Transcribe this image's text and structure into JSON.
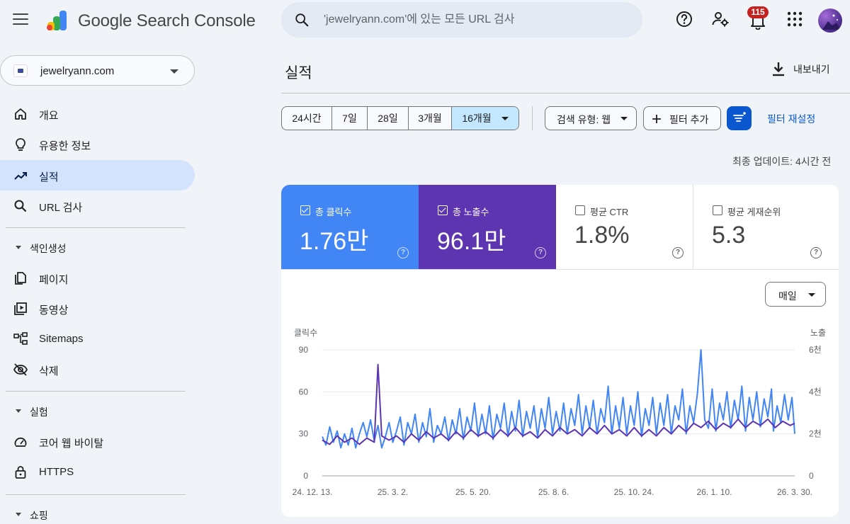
{
  "header": {
    "brand": "Google Search Console",
    "search_placeholder": "'jewelryann.com'에 있는 모든 URL 검사",
    "notifications_count": "115",
    "icons": [
      "menu-icon",
      "search-icon",
      "help-icon",
      "manage-users-icon",
      "notifications-icon",
      "apps-icon"
    ]
  },
  "sidebar": {
    "property": "jewelryann.com",
    "items": [
      {
        "label": "개요",
        "icon": "home-icon"
      },
      {
        "label": "유용한 정보",
        "icon": "lightbulb-icon"
      },
      {
        "label": "실적",
        "icon": "trending-up-icon",
        "active": true
      },
      {
        "label": "URL 검사",
        "icon": "search-icon"
      }
    ],
    "sections": [
      {
        "label": "색인생성",
        "items": [
          {
            "label": "페이지",
            "icon": "pages-icon"
          },
          {
            "label": "동영상",
            "icon": "video-icon"
          },
          {
            "label": "Sitemaps",
            "icon": "sitemap-icon"
          },
          {
            "label": "삭제",
            "icon": "visibility-off-icon"
          }
        ]
      },
      {
        "label": "실험",
        "items": [
          {
            "label": "코어 웹 바이탈",
            "icon": "speed-icon"
          },
          {
            "label": "HTTPS",
            "icon": "lock-icon"
          }
        ]
      },
      {
        "label": "쇼핑",
        "items": []
      }
    ]
  },
  "main": {
    "title": "실적",
    "export_label": "내보내기",
    "ranges": [
      "24시간",
      "7일",
      "28일",
      "3개월",
      "16개월"
    ],
    "selected_range": "16개월",
    "search_type": "검색 유형: 웹",
    "add_filter": "필터 추가",
    "reset_filters": "필터 재설정",
    "last_updated": "최종 업데이트: 4시간 전",
    "granularity": "매일",
    "colors": {
      "clicks": "#4285f4",
      "impressions": "#5e35b1",
      "primary": "#0b57d0"
    }
  },
  "metrics": [
    {
      "label": "총 클릭수",
      "value": "1.76만",
      "checked": true
    },
    {
      "label": "총 노출수",
      "value": "96.1만",
      "checked": true
    },
    {
      "label": "평균 CTR",
      "value": "1.8%",
      "checked": false
    },
    {
      "label": "평균 게재순위",
      "value": "5.3",
      "checked": false
    }
  ],
  "chart_data": {
    "type": "line",
    "left_axis_label": "클릭수",
    "right_axis_label": "노출",
    "left_ticks": [
      "90",
      "60",
      "30",
      "0"
    ],
    "right_ticks": [
      "6천",
      "4천",
      "2천",
      "0"
    ],
    "ylim_left": [
      0,
      90
    ],
    "ylim_right": [
      0,
      6000
    ],
    "x_tick_labels": [
      "24. 12. 13.",
      "25. 3. 2.",
      "25. 5. 20.",
      "25. 8. 6.",
      "25. 10. 24.",
      "26. 1. 10.",
      "26. 3. 30."
    ],
    "series": [
      {
        "name": "클릭수",
        "axis": "left",
        "color": "#4285f4",
        "points": [
          [
            0,
            28
          ],
          [
            4,
            22
          ],
          [
            8,
            35
          ],
          [
            12,
            24
          ],
          [
            16,
            32
          ],
          [
            20,
            20
          ],
          [
            24,
            30
          ],
          [
            28,
            22
          ],
          [
            32,
            34
          ],
          [
            36,
            20
          ],
          [
            40,
            30
          ],
          [
            44,
            38
          ],
          [
            48,
            28
          ],
          [
            52,
            40
          ],
          [
            56,
            25
          ],
          [
            60,
            36
          ],
          [
            64,
            20
          ],
          [
            68,
            28
          ],
          [
            72,
            38
          ],
          [
            76,
            24
          ],
          [
            80,
            32
          ],
          [
            84,
            42
          ],
          [
            88,
            22
          ],
          [
            92,
            38
          ],
          [
            96,
            30
          ],
          [
            100,
            44
          ],
          [
            104,
            24
          ],
          [
            108,
            38
          ],
          [
            112,
            28
          ],
          [
            116,
            48
          ],
          [
            120,
            24
          ],
          [
            124,
            36
          ],
          [
            128,
            30
          ],
          [
            132,
            42
          ],
          [
            136,
            25
          ],
          [
            140,
            40
          ],
          [
            144,
            30
          ],
          [
            148,
            48
          ],
          [
            152,
            26
          ],
          [
            156,
            42
          ],
          [
            160,
            32
          ],
          [
            164,
            52
          ],
          [
            168,
            28
          ],
          [
            172,
            44
          ],
          [
            176,
            30
          ],
          [
            180,
            50
          ],
          [
            184,
            26
          ],
          [
            188,
            44
          ],
          [
            192,
            34
          ],
          [
            196,
            52
          ],
          [
            200,
            28
          ],
          [
            204,
            46
          ],
          [
            208,
            32
          ],
          [
            212,
            54
          ],
          [
            216,
            28
          ],
          [
            220,
            46
          ],
          [
            224,
            34
          ],
          [
            228,
            50
          ],
          [
            232,
            28
          ],
          [
            236,
            48
          ],
          [
            240,
            34
          ],
          [
            244,
            56
          ],
          [
            248,
            30
          ],
          [
            252,
            46
          ],
          [
            256,
            32
          ],
          [
            260,
            52
          ],
          [
            264,
            30
          ],
          [
            268,
            48
          ],
          [
            272,
            36
          ],
          [
            276,
            58
          ],
          [
            280,
            30
          ],
          [
            284,
            50
          ],
          [
            288,
            34
          ],
          [
            292,
            54
          ],
          [
            296,
            30
          ],
          [
            300,
            48
          ],
          [
            304,
            38
          ],
          [
            308,
            64
          ],
          [
            312,
            30
          ],
          [
            316,
            50
          ],
          [
            320,
            34
          ],
          [
            324,
            56
          ],
          [
            328,
            30
          ],
          [
            332,
            50
          ],
          [
            336,
            36
          ],
          [
            340,
            60
          ],
          [
            344,
            28
          ],
          [
            348,
            48
          ],
          [
            352,
            36
          ],
          [
            356,
            56
          ],
          [
            360,
            30
          ],
          [
            364,
            52
          ],
          [
            368,
            36
          ],
          [
            372,
            58
          ],
          [
            376,
            30
          ],
          [
            380,
            50
          ],
          [
            384,
            40
          ],
          [
            388,
            62
          ],
          [
            392,
            30
          ],
          [
            396,
            50
          ],
          [
            400,
            38
          ],
          [
            404,
            58
          ],
          [
            408,
            90
          ],
          [
            412,
            40
          ],
          [
            416,
            34
          ],
          [
            420,
            62
          ],
          [
            424,
            32
          ],
          [
            428,
            52
          ],
          [
            432,
            40
          ],
          [
            436,
            60
          ],
          [
            440,
            34
          ],
          [
            444,
            54
          ],
          [
            448,
            40
          ],
          [
            452,
            64
          ],
          [
            456,
            32
          ],
          [
            460,
            56
          ],
          [
            464,
            40
          ],
          [
            468,
            60
          ],
          [
            472,
            35
          ],
          [
            476,
            55
          ],
          [
            480,
            42
          ],
          [
            484,
            62
          ],
          [
            486,
            32
          ],
          [
            490,
            50
          ],
          [
            494,
            38
          ],
          [
            498,
            58
          ],
          [
            502,
            40
          ],
          [
            506,
            56
          ],
          [
            509,
            30
          ]
        ]
      },
      {
        "name": "노출",
        "axis": "right",
        "color": "#5e35b1",
        "points": [
          [
            0,
            1700
          ],
          [
            8,
            1500
          ],
          [
            16,
            1900
          ],
          [
            24,
            1600
          ],
          [
            32,
            1800
          ],
          [
            40,
            1500
          ],
          [
            48,
            1800
          ],
          [
            56,
            1600
          ],
          [
            60,
            5300
          ],
          [
            64,
            1900
          ],
          [
            72,
            1700
          ],
          [
            80,
            1900
          ],
          [
            88,
            1600
          ],
          [
            96,
            2000
          ],
          [
            104,
            1700
          ],
          [
            112,
            2100
          ],
          [
            120,
            1800
          ],
          [
            128,
            2000
          ],
          [
            136,
            1700
          ],
          [
            144,
            2100
          ],
          [
            152,
            1800
          ],
          [
            160,
            2200
          ],
          [
            168,
            1900
          ],
          [
            176,
            2100
          ],
          [
            184,
            1800
          ],
          [
            192,
            2200
          ],
          [
            200,
            1900
          ],
          [
            208,
            2300
          ],
          [
            216,
            1900
          ],
          [
            224,
            2100
          ],
          [
            232,
            1800
          ],
          [
            240,
            2200
          ],
          [
            248,
            1900
          ],
          [
            256,
            2300
          ],
          [
            264,
            2000
          ],
          [
            272,
            2200
          ],
          [
            280,
            1900
          ],
          [
            288,
            2300
          ],
          [
            296,
            2000
          ],
          [
            304,
            2400
          ],
          [
            312,
            2000
          ],
          [
            320,
            2200
          ],
          [
            328,
            1900
          ],
          [
            336,
            2300
          ],
          [
            344,
            1900
          ],
          [
            352,
            2200
          ],
          [
            360,
            1900
          ],
          [
            368,
            2300
          ],
          [
            376,
            2000
          ],
          [
            384,
            2400
          ],
          [
            392,
            2100
          ],
          [
            400,
            2500
          ],
          [
            408,
            2300
          ],
          [
            416,
            2600
          ],
          [
            424,
            2200
          ],
          [
            432,
            2500
          ],
          [
            440,
            2300
          ],
          [
            448,
            2700
          ],
          [
            456,
            2300
          ],
          [
            464,
            2600
          ],
          [
            472,
            2400
          ],
          [
            480,
            2700
          ],
          [
            488,
            2300
          ],
          [
            496,
            2600
          ],
          [
            504,
            2400
          ],
          [
            509,
            2500
          ]
        ]
      }
    ]
  }
}
